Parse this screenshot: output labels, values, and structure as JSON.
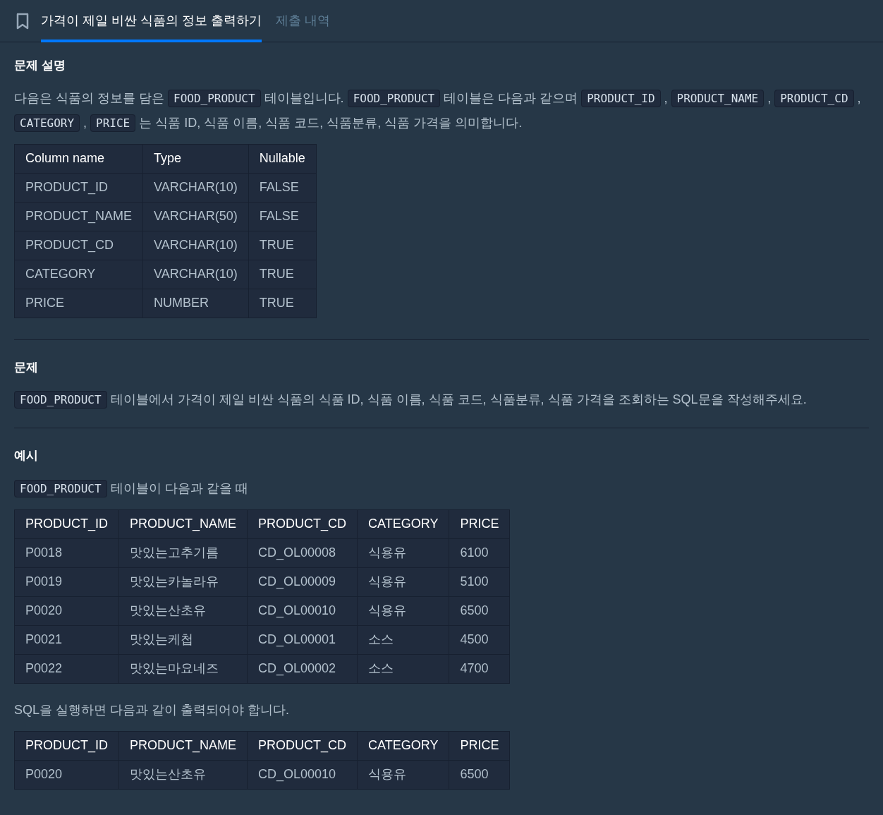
{
  "tabs": [
    {
      "label": "가격이 제일 비싼 식품의 정보 출력하기",
      "selected": true
    },
    {
      "label": "제출 내역",
      "selected": false
    }
  ],
  "sections": [
    {
      "heading": "문제 설명",
      "blocks": [
        {
          "kind": "paragraph",
          "parts": [
            {
              "kind": "text",
              "text": "다음은 식품의 정보를 담은 "
            },
            {
              "kind": "code",
              "text": "FOOD_PRODUCT"
            },
            {
              "kind": "text",
              "text": " 테이블입니다. "
            },
            {
              "kind": "code",
              "text": "FOOD_PRODUCT"
            },
            {
              "kind": "text",
              "text": " 테이블은 다음과 같으며 "
            },
            {
              "kind": "code",
              "text": "PRODUCT_ID"
            },
            {
              "kind": "text",
              "text": " , "
            },
            {
              "kind": "code",
              "text": "PRODUCT_NAME"
            },
            {
              "kind": "text",
              "text": " , "
            },
            {
              "kind": "code",
              "text": "PRODUCT_CD"
            },
            {
              "kind": "text",
              "text": " , "
            },
            {
              "kind": "code",
              "text": "CATEGORY"
            },
            {
              "kind": "text",
              "text": " , "
            },
            {
              "kind": "code",
              "text": "PRICE"
            },
            {
              "kind": "text",
              "text": " 는 식품 ID, 식품 이름, 식품 코드, 식품분류, 식품 가격을 의미합니다."
            }
          ]
        },
        {
          "kind": "table",
          "columns": [
            "Column name",
            "Type",
            "Nullable"
          ],
          "rows": [
            [
              "PRODUCT_ID",
              "VARCHAR(10)",
              "FALSE"
            ],
            [
              "PRODUCT_NAME",
              "VARCHAR(50)",
              "FALSE"
            ],
            [
              "PRODUCT_CD",
              "VARCHAR(10)",
              "TRUE"
            ],
            [
              "CATEGORY",
              "VARCHAR(10)",
              "TRUE"
            ],
            [
              "PRICE",
              "NUMBER",
              "TRUE"
            ]
          ]
        }
      ]
    },
    {
      "heading": "문제",
      "blocks": [
        {
          "kind": "paragraph",
          "parts": [
            {
              "kind": "code",
              "text": "FOOD_PRODUCT"
            },
            {
              "kind": "text",
              "text": " 테이블에서 가격이 제일 비싼 식품의 식품 ID, 식품 이름, 식품 코드, 식품분류, 식품 가격을 조회하는 SQL문을 작성해주세요."
            }
          ]
        }
      ]
    },
    {
      "heading": "예시",
      "blocks": [
        {
          "kind": "paragraph",
          "parts": [
            {
              "kind": "code",
              "text": "FOOD_PRODUCT"
            },
            {
              "kind": "text",
              "text": " 테이블이 다음과 같을 때"
            }
          ]
        },
        {
          "kind": "table",
          "columns": [
            "PRODUCT_ID",
            "PRODUCT_NAME",
            "PRODUCT_CD",
            "CATEGORY",
            "PRICE"
          ],
          "rows": [
            [
              "P0018",
              "맛있는고추기름",
              "CD_OL00008",
              "식용유",
              "6100"
            ],
            [
              "P0019",
              "맛있는카놀라유",
              "CD_OL00009",
              "식용유",
              "5100"
            ],
            [
              "P0020",
              "맛있는산초유",
              "CD_OL00010",
              "식용유",
              "6500"
            ],
            [
              "P0021",
              "맛있는케첩",
              "CD_OL00001",
              "소스",
              "4500"
            ],
            [
              "P0022",
              "맛있는마요네즈",
              "CD_OL00002",
              "소스",
              "4700"
            ]
          ]
        },
        {
          "kind": "paragraph",
          "parts": [
            {
              "kind": "text",
              "text": "SQL을 실행하면 다음과 같이 출력되어야 합니다."
            }
          ]
        },
        {
          "kind": "table",
          "columns": [
            "PRODUCT_ID",
            "PRODUCT_NAME",
            "PRODUCT_CD",
            "CATEGORY",
            "PRICE"
          ],
          "rows": [
            [
              "P0020",
              "맛있는산초유",
              "CD_OL00010",
              "식용유",
              "6500"
            ]
          ]
        }
      ]
    }
  ]
}
